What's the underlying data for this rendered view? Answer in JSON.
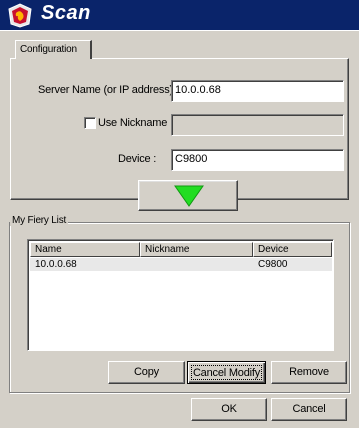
{
  "window": {
    "title": "Scan"
  },
  "configuration": {
    "tab_label": "Configuration",
    "server_label": "Server Name (or IP address) :",
    "server_value": "10.0.0.68",
    "use_nickname_label": "Use Nickname :",
    "use_nickname_checked": false,
    "nickname_value": "",
    "device_label": "Device :",
    "device_value": "C9800"
  },
  "fiery_list": {
    "group_label": "My Fiery List",
    "columns": [
      "Name",
      "Nickname",
      "Device"
    ],
    "rows": [
      {
        "name": "10.0.0.68",
        "nickname": "",
        "device": "C9800"
      }
    ]
  },
  "list_buttons": {
    "copy": "Copy",
    "cancel_modify": "Cancel Modify",
    "remove": "Remove"
  },
  "dialog_buttons": {
    "ok": "OK",
    "cancel": "Cancel"
  },
  "icons": {
    "logo": "fiery-logo-icon",
    "arrow": "arrow-down-icon"
  },
  "colors": {
    "title_bar": "#0a246a",
    "arrow_green": "#22dd22",
    "dialog_bg": "#d4d0c8",
    "selected_row": "#e8e8e8"
  }
}
